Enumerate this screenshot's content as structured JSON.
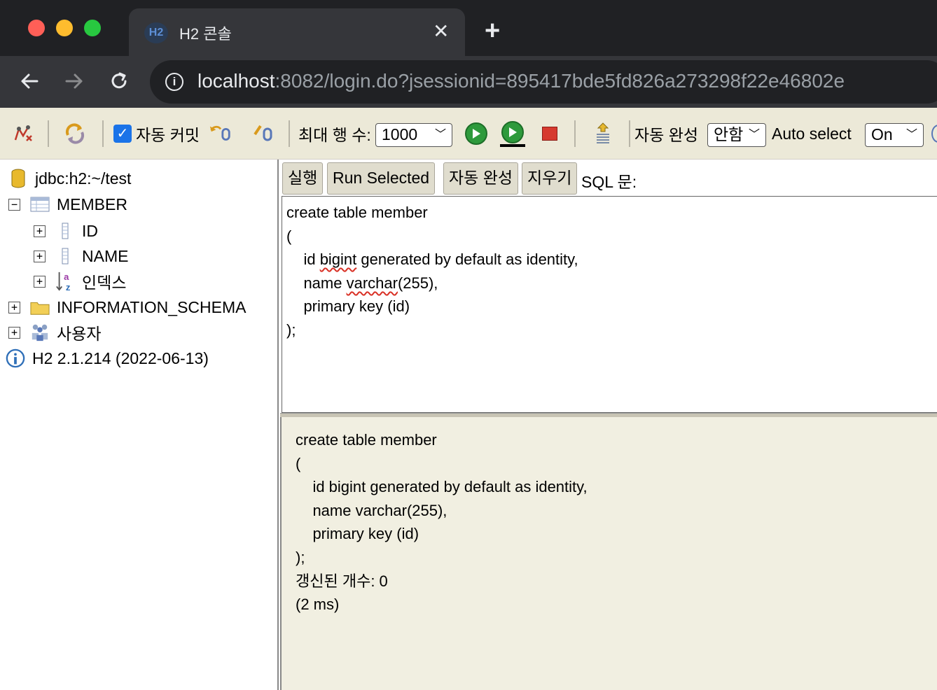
{
  "browser": {
    "tab_title": "H2 콘솔",
    "tab_favicon": "H2",
    "url_host": "localhost",
    "url_rest": ":8082/login.do?jsessionid=895417bde5fd826a273298f22e46802e"
  },
  "toolbar": {
    "autocommit_label": "자동 커밋",
    "autocommit_checked": true,
    "max_rows_label": "최대 행 수:",
    "max_rows_value": "1000",
    "autocomplete_label": "자동 완성",
    "autocomplete_value": "안함",
    "autoselect_label": "Auto select",
    "autoselect_value": "On"
  },
  "tree": {
    "connection": "jdbc:h2:~/test",
    "table": "MEMBER",
    "columns": [
      "ID",
      "NAME"
    ],
    "indexes_label": "인덱스",
    "schema": "INFORMATION_SCHEMA",
    "users": "사용자",
    "version": "H2 2.1.214 (2022-06-13)"
  },
  "actions": {
    "run": "실행",
    "run_selected": "Run Selected",
    "autocomplete": "자동 완성",
    "clear": "지우기",
    "sql_label": "SQL 문:"
  },
  "editor": {
    "lines": [
      "create table member",
      "(",
      "    id bigint generated by default as identity,",
      "    name varchar(255),",
      "    primary key (id)",
      ");"
    ]
  },
  "result": {
    "lines": [
      "create table member",
      "(",
      "    id bigint generated by default as identity,",
      "    name varchar(255),",
      "    primary key (id)",
      ");",
      "갱신된 개수: 0",
      "(2 ms)"
    ]
  }
}
